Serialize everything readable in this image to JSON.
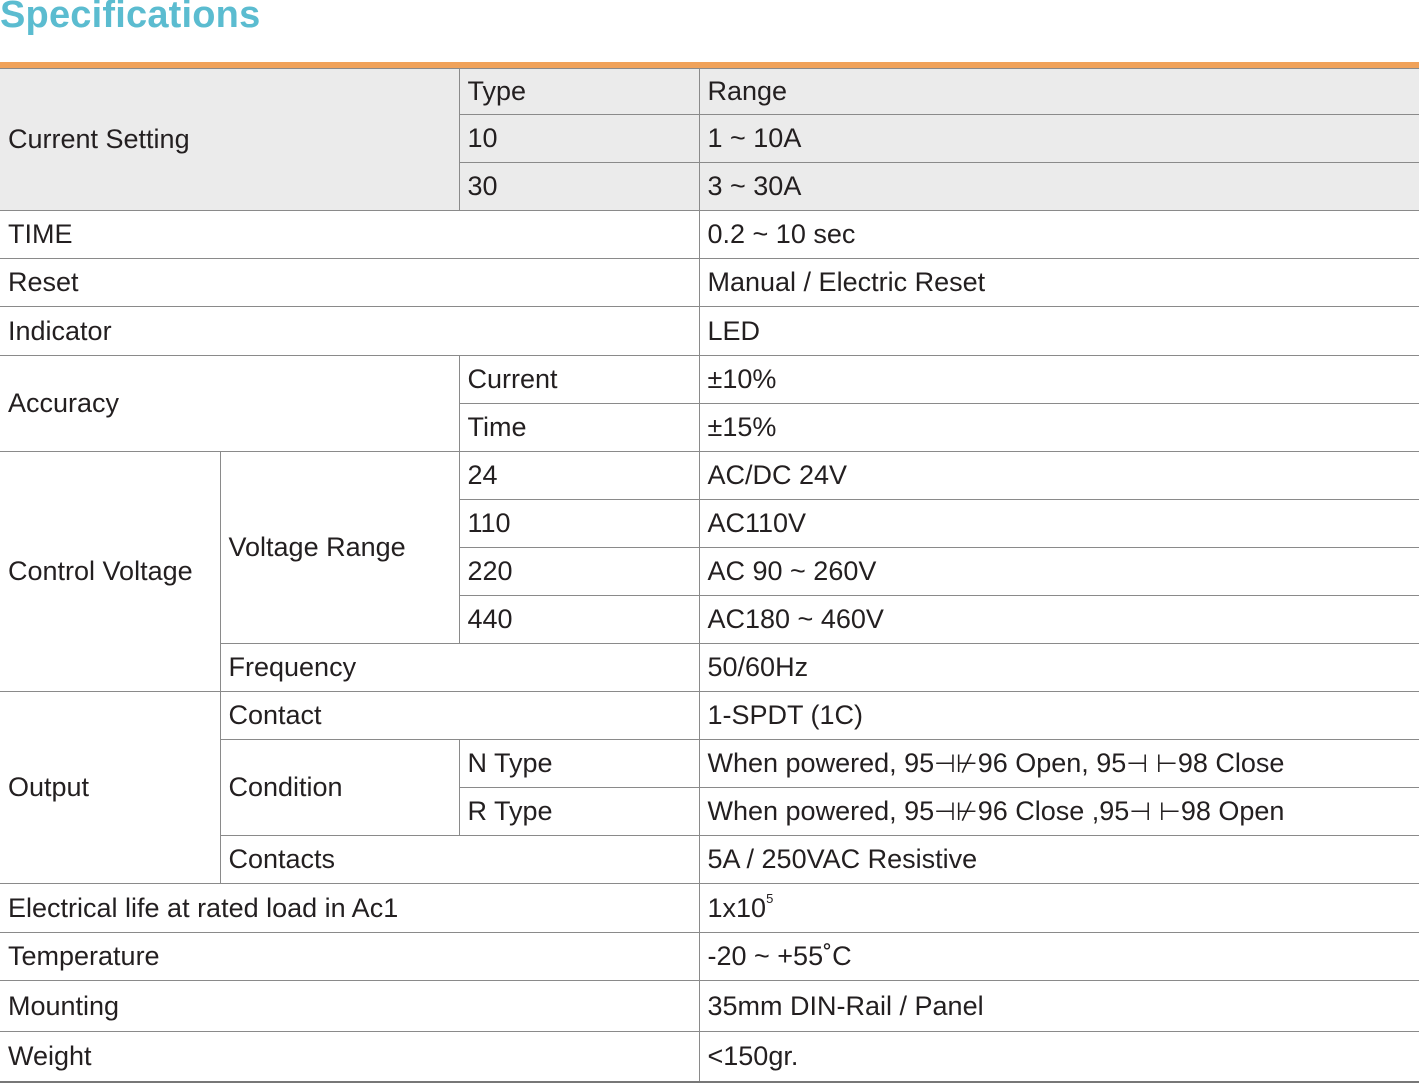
{
  "title": "Specifications",
  "current_setting": {
    "label": "Current Setting",
    "type_header": "Type",
    "range_header": "Range",
    "rows": [
      {
        "type": "10",
        "range": "1 ~ 10A"
      },
      {
        "type": "30",
        "range": "3 ~ 30A"
      }
    ]
  },
  "time": {
    "label": "TIME",
    "value": "0.2 ~ 10 sec"
  },
  "reset": {
    "label": "Reset",
    "value": "Manual / Electric Reset"
  },
  "indicator": {
    "label": "Indicator",
    "value": "LED"
  },
  "accuracy": {
    "label": "Accuracy",
    "current_label": "Current",
    "current_value": "±10%",
    "time_label": "Time",
    "time_value": "±15%"
  },
  "control_voltage": {
    "label": "Control Voltage",
    "voltage_range_label": "Voltage Range",
    "ranges": [
      {
        "code": "24",
        "value": "AC/DC  24V"
      },
      {
        "code": "110",
        "value": "AC110V"
      },
      {
        "code": "220",
        "value": "AC 90 ~ 260V"
      },
      {
        "code": "440",
        "value": "AC180 ~ 460V"
      }
    ],
    "frequency_label": "Frequency",
    "frequency_value": "50/60Hz"
  },
  "output": {
    "label": "Output",
    "contact_label": "Contact",
    "contact_value": "1-SPDT (1C)",
    "condition_label": "Condition",
    "n_type": {
      "label": "N Type",
      "prefix": "When powered, 95",
      "nc_symbol": "⊣⊬",
      "mid": "96 Open, 95",
      "no_symbol": "⊣ ⊢",
      "suffix": "98 Close"
    },
    "r_type": {
      "label": "R Type",
      "prefix": "When powered, 95",
      "nc_symbol": "⊣⊬",
      "mid": "96 Close ,95",
      "no_symbol": "⊣ ⊢",
      "suffix": "98 Open"
    },
    "contacts_label": "Contacts",
    "contacts_value": "5A / 250VAC Resistive"
  },
  "electrical_life": {
    "label": "Electrical life at rated load in Ac1",
    "base": "1x10",
    "exponent": "5"
  },
  "temperature": {
    "label": "Temperature",
    "value": "-20 ~ +55˚C"
  },
  "mounting": {
    "label": "Mounting",
    "value": "35mm DIN-Rail / Panel"
  },
  "weight": {
    "label": "Weight",
    "value": "<150gr."
  }
}
